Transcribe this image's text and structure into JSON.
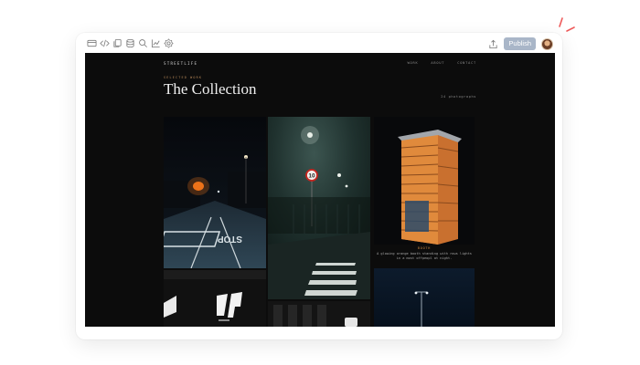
{
  "toolbar": {
    "icons": [
      "panel-icon",
      "code-icon",
      "copy-icon",
      "database-icon",
      "search-icon",
      "chart-icon",
      "settings-icon"
    ]
  },
  "actions": {
    "publish_label": "Publish"
  },
  "site": {
    "brand": "STREETLIFE",
    "nav": [
      "WORK",
      "ABOUT",
      "CONTACT"
    ],
    "eyebrow": "SELECTED WORK",
    "title": "The Collection",
    "count": "24 photographs"
  },
  "gallery": {
    "caption_tag": "BOOTH",
    "caption_text": "A glowing orange booth standing with rows lights in a most offpeopl at night.",
    "street_text": "STOP",
    "sign_text": "10"
  },
  "colors": {
    "accent_orange": "#c98a45",
    "publish_bg": "#a9b6c8",
    "page_bg": "#0c0c0c"
  }
}
